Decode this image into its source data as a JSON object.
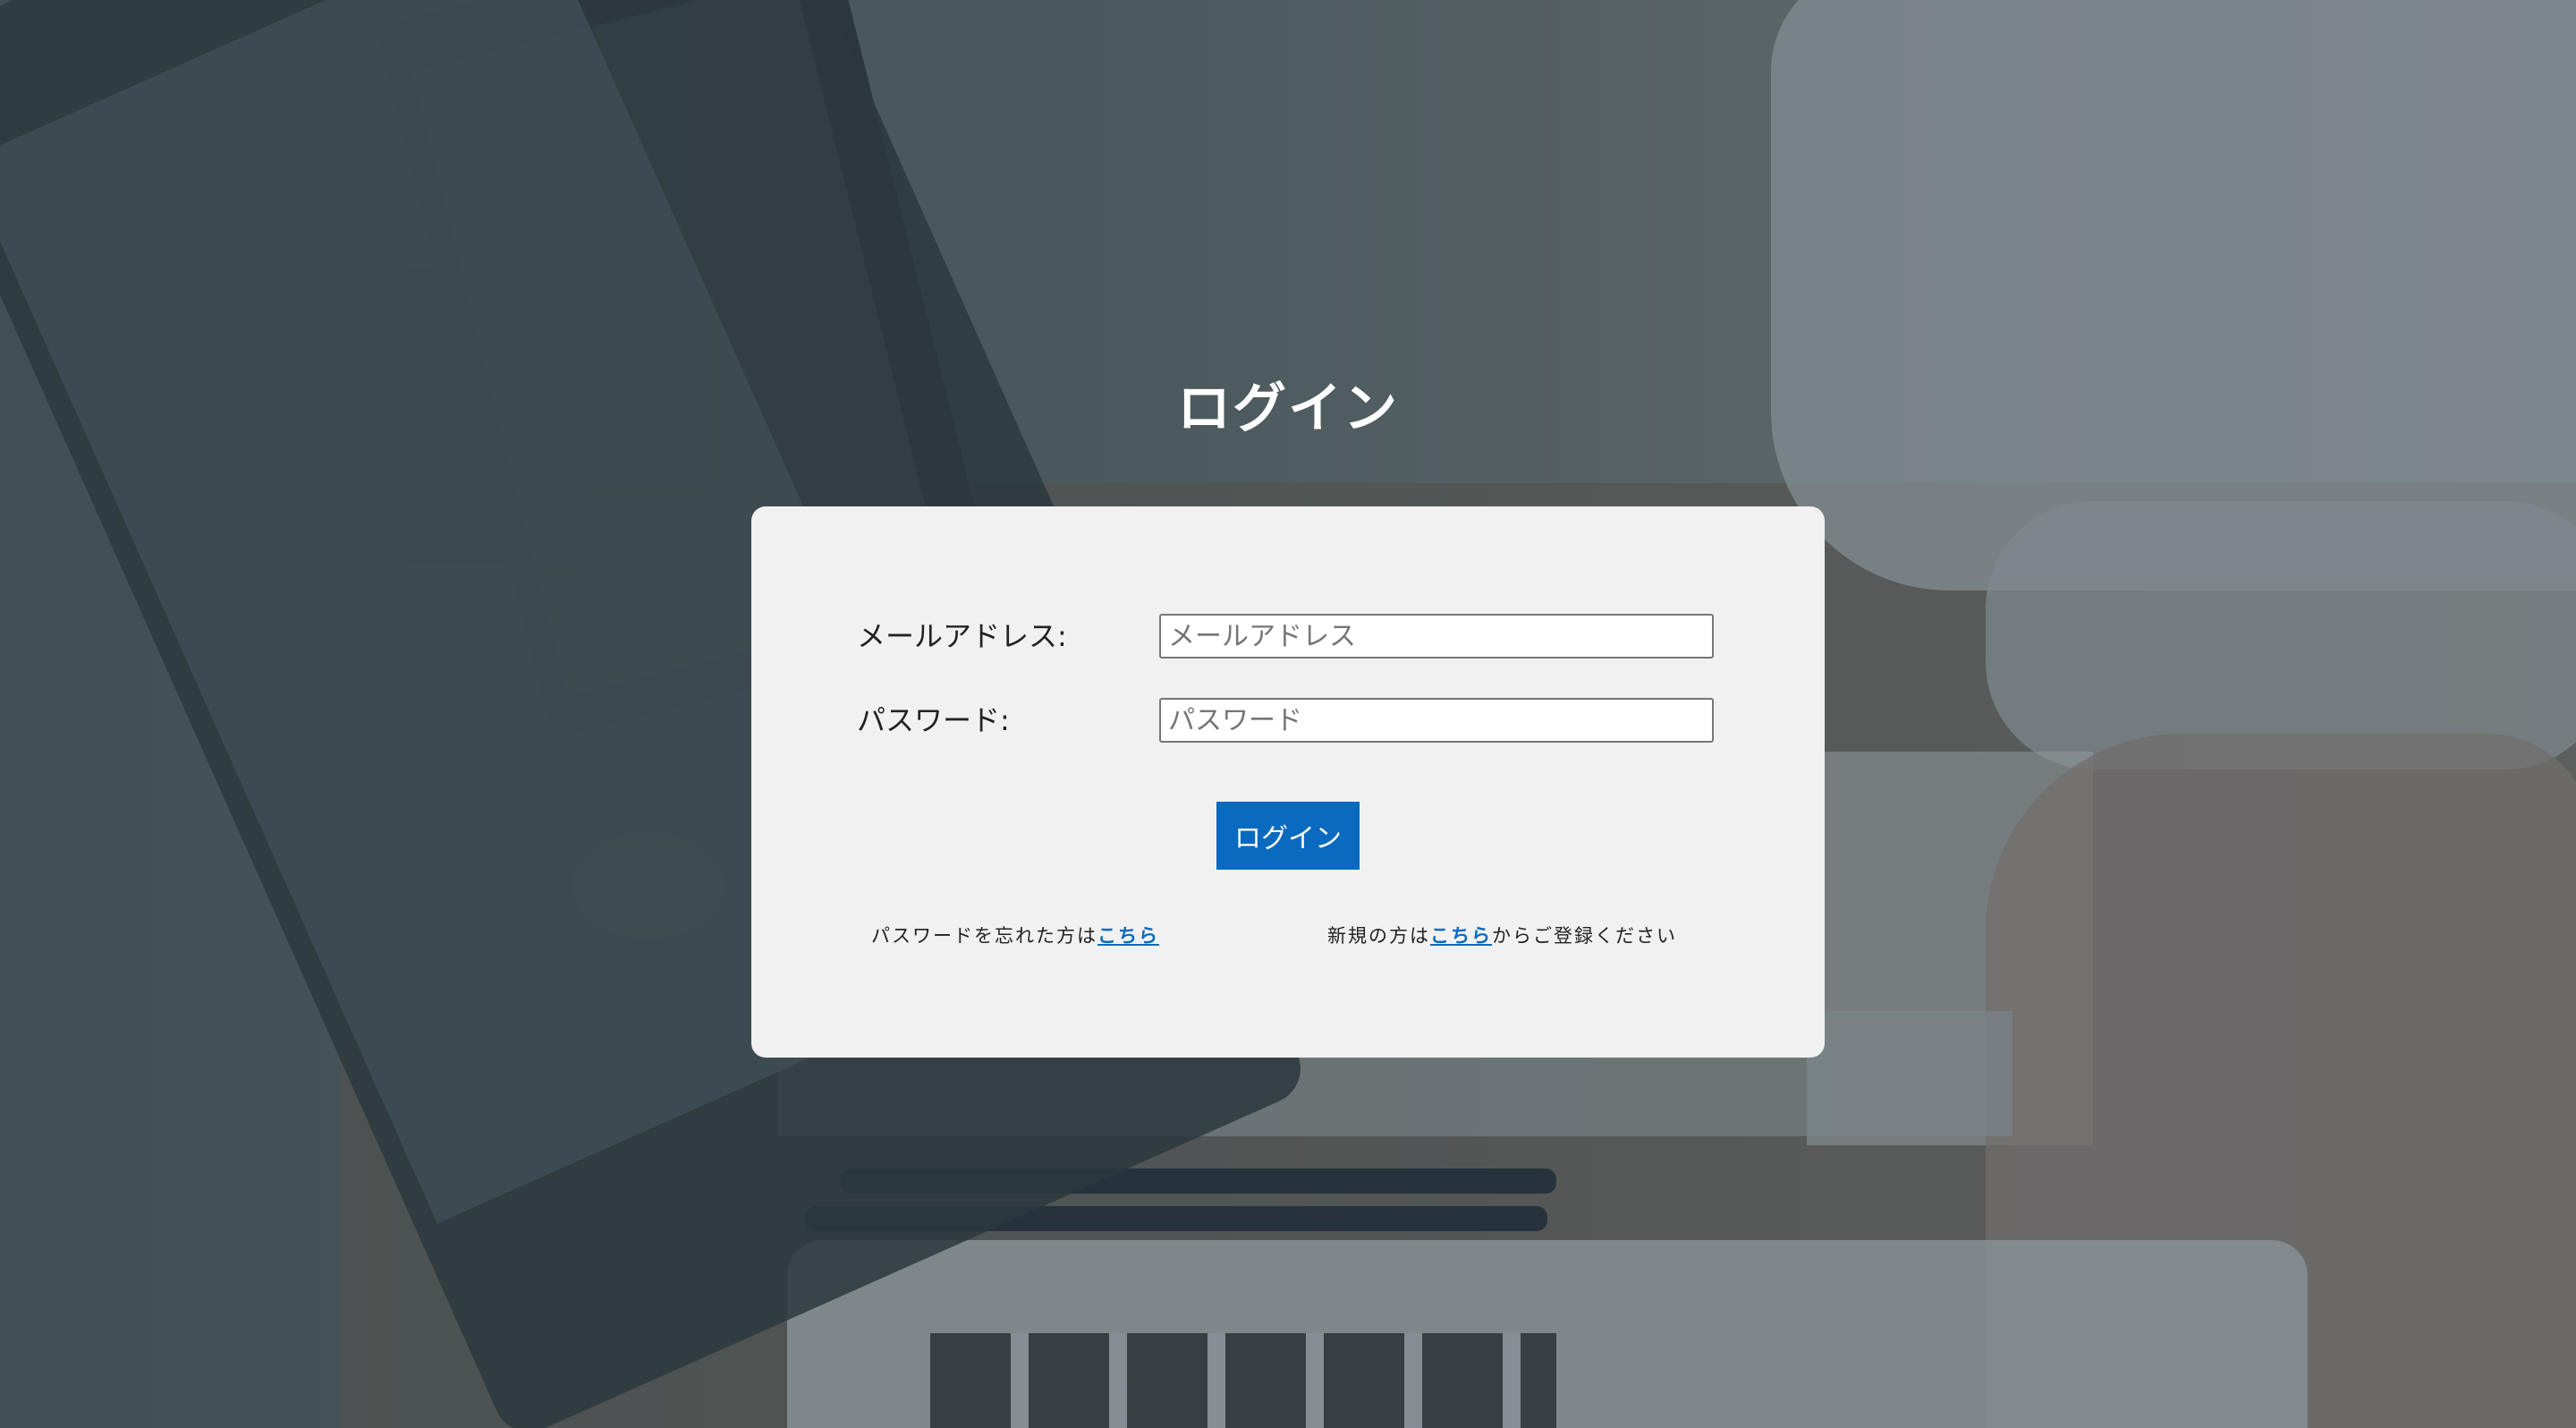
{
  "page": {
    "title": "ログイン"
  },
  "form": {
    "email_label": "メールアドレス:",
    "email_placeholder": "メールアドレス",
    "email_value": "",
    "password_label": "パスワード:",
    "password_placeholder": "パスワード",
    "password_value": "",
    "submit_label": "ログイン"
  },
  "footer": {
    "forgot_prefix": "パスワードを忘れた方は",
    "forgot_link": "こちら",
    "register_prefix": "新規の方は",
    "register_link": "こちら",
    "register_suffix": "からご登録ください"
  },
  "colors": {
    "accent": "#0a6abf",
    "card_background": "#f1f1f1",
    "title_text": "#ffffff"
  }
}
